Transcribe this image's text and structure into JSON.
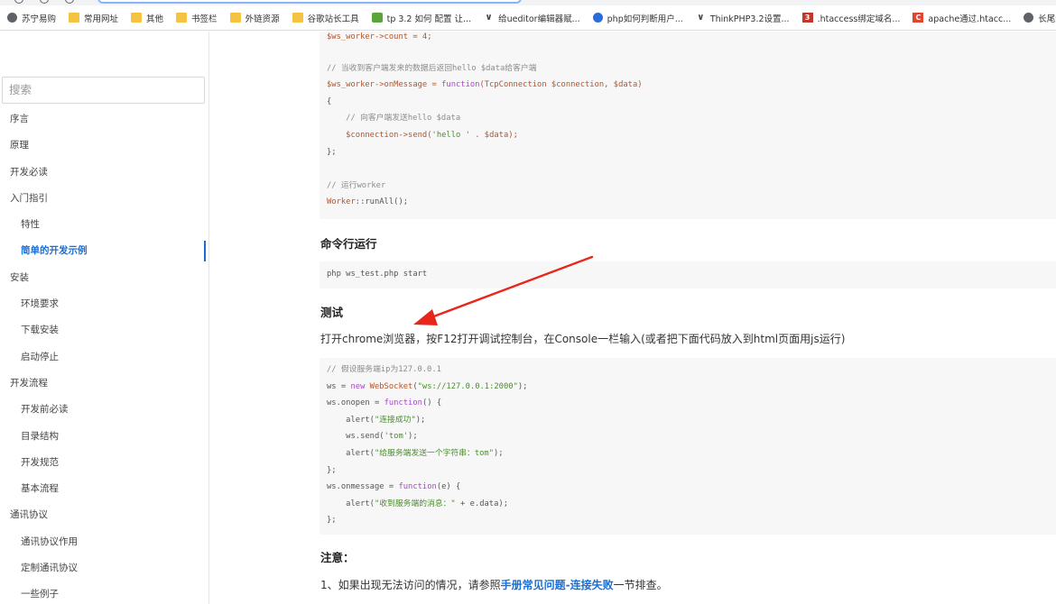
{
  "bookmarks": [
    {
      "label": "苏宁易购",
      "icon": "globe-icon",
      "kind": "globe"
    },
    {
      "label": "常用网址",
      "icon": "folder-icon",
      "kind": "folder"
    },
    {
      "label": "其他",
      "icon": "folder-icon",
      "kind": "folder"
    },
    {
      "label": "书签栏",
      "icon": "folder-icon",
      "kind": "folder"
    },
    {
      "label": "外链资源",
      "icon": "folder-icon",
      "kind": "folder"
    },
    {
      "label": "谷歌站长工具",
      "icon": "folder-icon",
      "kind": "folder"
    },
    {
      "label": "tp 3.2 如何 配置 让...",
      "icon": "pencil-icon",
      "kind": "green"
    },
    {
      "label": "给ueditor编辑器赋...",
      "icon": "vw-icon",
      "kind": "vw"
    },
    {
      "label": "php如何判断用户...",
      "icon": "paw-icon",
      "kind": "paw"
    },
    {
      "label": "ThinkPHP3.2设置...",
      "icon": "vw-icon",
      "kind": "vw"
    },
    {
      "label": ".htaccess绑定域名...",
      "icon": "b3-icon",
      "kind": "b3"
    },
    {
      "label": "apache通过.htacc...",
      "icon": "c-icon",
      "kind": "cred"
    },
    {
      "label": "长尾词挖掘工",
      "icon": "globe-icon",
      "kind": "globe"
    }
  ],
  "sidebar": {
    "search_placeholder": "搜索",
    "items": [
      {
        "label": "序言",
        "level": 1
      },
      {
        "label": "原理",
        "level": 1
      },
      {
        "label": "开发必读",
        "level": 1
      },
      {
        "label": "入门指引",
        "level": 1
      },
      {
        "label": "特性",
        "level": 2
      },
      {
        "label": "简单的开发示例",
        "level": 2,
        "active": true
      },
      {
        "label": "安装",
        "level": 1
      },
      {
        "label": "环境要求",
        "level": 2
      },
      {
        "label": "下载安装",
        "level": 2
      },
      {
        "label": "启动停止",
        "level": 2
      },
      {
        "label": "开发流程",
        "level": 1
      },
      {
        "label": "开发前必读",
        "level": 2
      },
      {
        "label": "目录结构",
        "level": 2
      },
      {
        "label": "开发规范",
        "level": 2
      },
      {
        "label": "基本流程",
        "level": 2
      },
      {
        "label": "通讯协议",
        "level": 1
      },
      {
        "label": "通讯协议作用",
        "level": 2
      },
      {
        "label": "定制通讯协议",
        "level": 2
      },
      {
        "label": "一些例子",
        "level": 2
      }
    ]
  },
  "main": {
    "code1": {
      "count_line": "$ws_worker->count = 4;",
      "comment_recv": "// 当收到客户端发来的数据后返回hello $data给客户端",
      "onmessage_a": "$ws_worker->onMessage = ",
      "onmessage_kw": "function",
      "onmessage_b": "(TcpConnection $connection, $data)",
      "brace_open": "{",
      "comment_send": "    // 向客户端发送hello $data",
      "send_a": "    $connection->send(",
      "send_str": "'hello '",
      "send_b": " . $data);",
      "brace_close": "};",
      "comment_run": "// 运行worker",
      "run_a": "Worker",
      "run_b": "::runAll();"
    },
    "heading_cli": "命令行运行",
    "cli_cmd": "php ws_test.php start",
    "heading_test": "测试",
    "test_text": "打开chrome浏览器，按F12打开调试控制台，在Console一栏输入(或者把下面代码放入到html页面用js运行)",
    "code2": {
      "l1": "// 假设服务端ip为127.0.0.1",
      "l2a": "ws = ",
      "l2kw": "new",
      "l2cls": " WebSocket",
      "l2b": "(",
      "l2str": "\"ws://127.0.0.1:2000\"",
      "l2c": ");",
      "l3a": "ws.onopen = ",
      "l3kw": "function",
      "l3b": "() {",
      "l4a": "    alert(",
      "l4str": "\"连接成功\"",
      "l4b": ");",
      "l5a": "    ws.send(",
      "l5str": "'tom'",
      "l5b": ");",
      "l6a": "    alert(",
      "l6str": "\"给服务端发送一个字符串：tom\"",
      "l6b": ");",
      "l7": "};",
      "l8a": "ws.onmessage = ",
      "l8kw": "function",
      "l8b": "(e) {",
      "l9a": "    alert(",
      "l9str": "\"收到服务端的消息：\"",
      "l9b": " + e.data);",
      "l10": "};"
    },
    "heading_note": "注意：",
    "note_prefix": "1、如果出现无法访问的情况，请参照",
    "note_link": "手册常见问题-连接失败",
    "note_suffix": "一节排查。"
  },
  "colors": {
    "accent": "#1a6fd6",
    "arrow": "#e8271b",
    "code_bg": "#f7f7f7"
  }
}
